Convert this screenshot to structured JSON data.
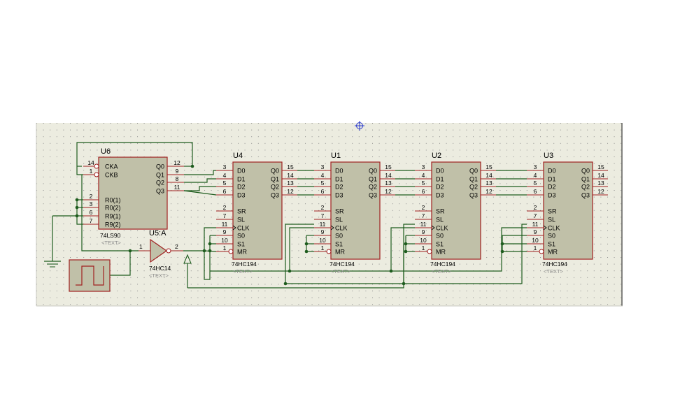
{
  "registers": [
    {
      "ref": "U4",
      "value": "74HC194",
      "text": "<TEXT>"
    },
    {
      "ref": "U1",
      "value": "74HC194",
      "text": "<TEXT>"
    },
    {
      "ref": "U2",
      "value": "74HC194",
      "text": "<TEXT>"
    },
    {
      "ref": "U3",
      "value": "74HC194",
      "text": "<TEXT>"
    }
  ],
  "reg_left_pins": [
    {
      "name": "D0",
      "num": "3"
    },
    {
      "name": "D1",
      "num": "4"
    },
    {
      "name": "D2",
      "num": "5"
    },
    {
      "name": "D3",
      "num": "6"
    },
    {
      "name": "SR",
      "num": "2"
    },
    {
      "name": "SL",
      "num": "7"
    },
    {
      "name": "CLK",
      "num": "11"
    },
    {
      "name": "S0",
      "num": "9"
    },
    {
      "name": "S1",
      "num": "10"
    },
    {
      "name": "MR",
      "num": "1"
    }
  ],
  "reg_right_pins": [
    {
      "name": "Q0",
      "num": "15"
    },
    {
      "name": "Q1",
      "num": "14"
    },
    {
      "name": "Q2",
      "num": "13"
    },
    {
      "name": "Q3",
      "num": "12"
    }
  ],
  "counter": {
    "ref": "U6",
    "value": "74LS90",
    "text": "<TEXT>",
    "left_pins": [
      {
        "name": "CKA",
        "num": "14"
      },
      {
        "name": "CKB",
        "num": "1"
      },
      {
        "name": "R0(1)",
        "num": "2"
      },
      {
        "name": "R0(2)",
        "num": "3"
      },
      {
        "name": "R9(1)",
        "num": "6"
      },
      {
        "name": "R9(2)",
        "num": "7"
      }
    ],
    "right_pins": [
      {
        "name": "Q0",
        "num": "12"
      },
      {
        "name": "Q1",
        "num": "9"
      },
      {
        "name": "Q2",
        "num": "8"
      },
      {
        "name": "Q3",
        "num": "11"
      }
    ]
  },
  "inverter": {
    "ref": "U5:A",
    "value": "74HC14",
    "text": "<TEXT>",
    "in_pin": "1",
    "out_pin": "2"
  },
  "icons": [
    "ground-icon",
    "clock-source-icon",
    "probe-arrow-icon",
    "origin-crosshair-icon"
  ],
  "colors": {
    "wire": "#1e5c1e",
    "pin": "#a02020",
    "body": "#c0c0a8",
    "sheet": "#ecece0",
    "grid": "#8c8c8c"
  }
}
